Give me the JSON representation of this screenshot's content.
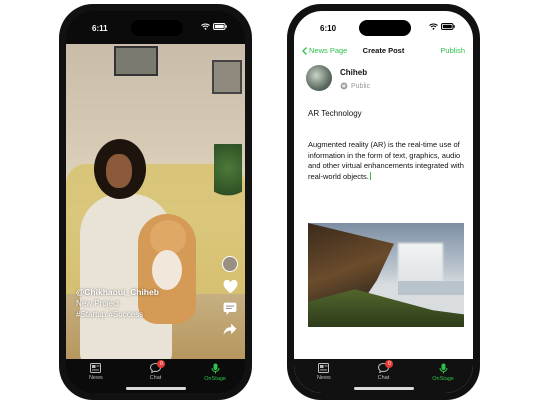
{
  "left_phone": {
    "status_time": "6:11",
    "feed": {
      "username": "@Chikhaoui_Chiheb",
      "project": "New Project",
      "tags": "#Startup #Success"
    },
    "tabs": [
      {
        "label": "News",
        "icon": "news-icon"
      },
      {
        "label": "Chat",
        "icon": "chat-icon",
        "badge": "0"
      },
      {
        "label": "OnStage",
        "icon": "microphone-icon"
      }
    ]
  },
  "right_phone": {
    "status_time": "6:10",
    "nav": {
      "back_label": "News Page",
      "title": "Create Post",
      "publish_label": "Publish"
    },
    "author": {
      "name": "Chiheb",
      "privacy": "Public"
    },
    "post": {
      "title": "AR Technology",
      "body": "Augmented reality (AR) is the real-time use of information in the form of text, graphics, audio and other virtual enhancements integrated with real-world objects."
    },
    "tabs": [
      {
        "label": "News",
        "icon": "news-icon"
      },
      {
        "label": "Chat",
        "icon": "chat-icon",
        "badge": "0"
      },
      {
        "label": "OnStage",
        "icon": "microphone-icon"
      }
    ]
  },
  "colors": {
    "accent_green": "#30c04a",
    "badge_red": "#e53935",
    "tabbar_bg": "#111111"
  }
}
